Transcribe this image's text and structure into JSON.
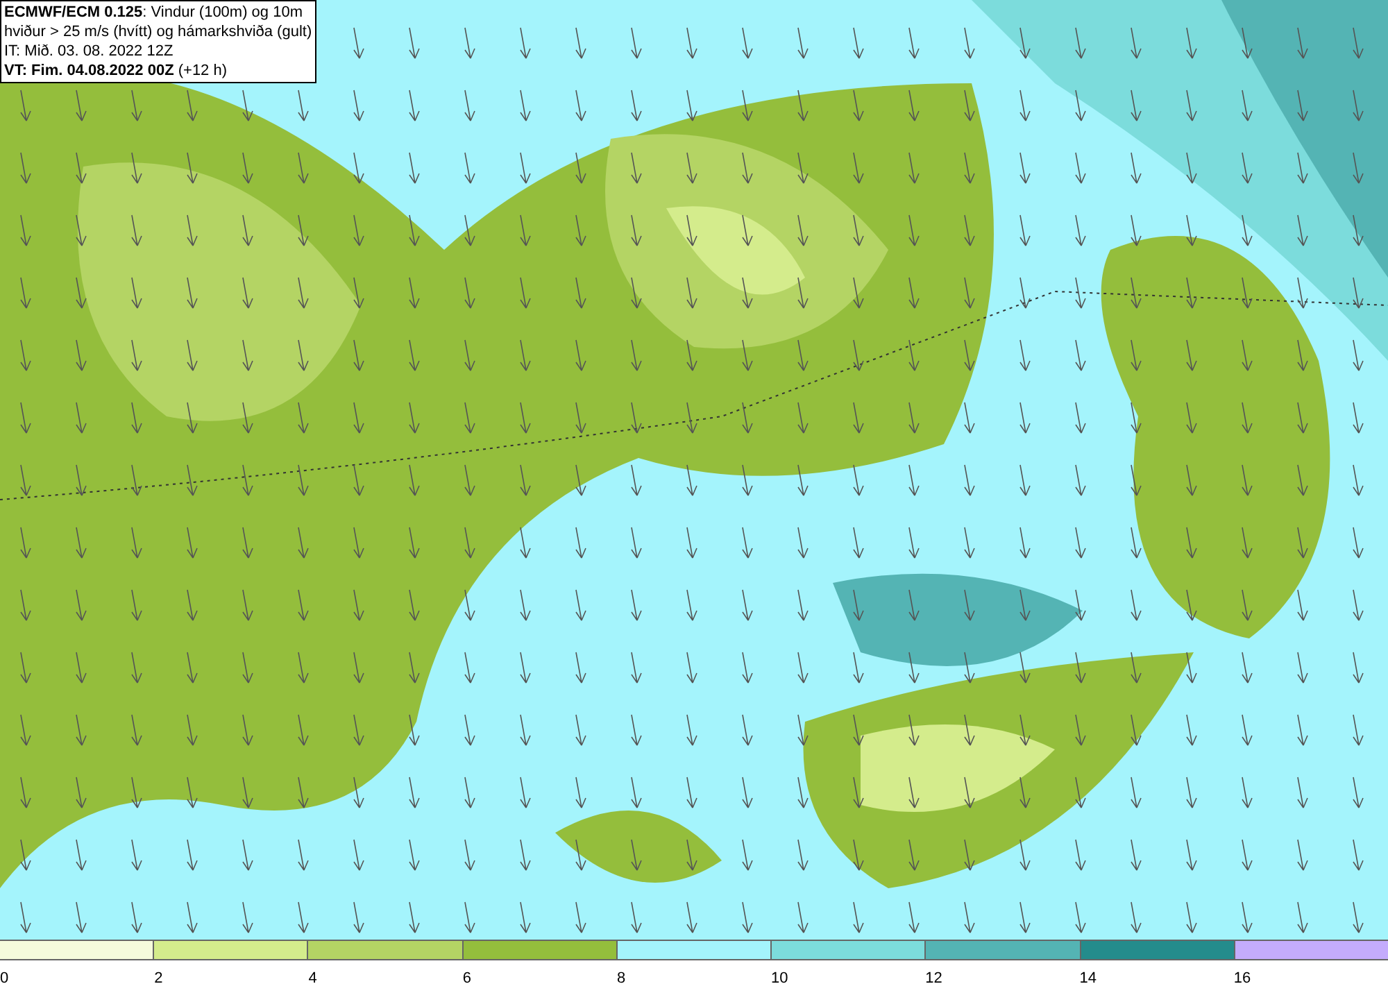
{
  "info_box": {
    "lines": [
      "**ECMWF/ECM 0.125**: Vindur (100m) og 10m",
      "hviður > 25 m/s (hvítt) og hámarkshviða (gult)",
      "IT: Mið. 03. 08. 2022 12Z",
      "**VT: Fim. 04.08.2022 00Z** (+12 h)"
    ]
  },
  "legend": [
    {
      "label": "0",
      "color": "#f5fbdc"
    },
    {
      "label": "2",
      "color": "#d4ec8c"
    },
    {
      "label": "4",
      "color": "#b4d464"
    },
    {
      "label": "6",
      "color": "#94be3c"
    },
    {
      "label": "8",
      "color": "#a4f4fc"
    },
    {
      "label": "10",
      "color": "#7cdcdc"
    },
    {
      "label": "12",
      "color": "#54b4b4"
    },
    {
      "label": "14",
      "color": "#248c8c"
    },
    {
      "label": "16",
      "color": "#c4acfc"
    }
  ]
}
